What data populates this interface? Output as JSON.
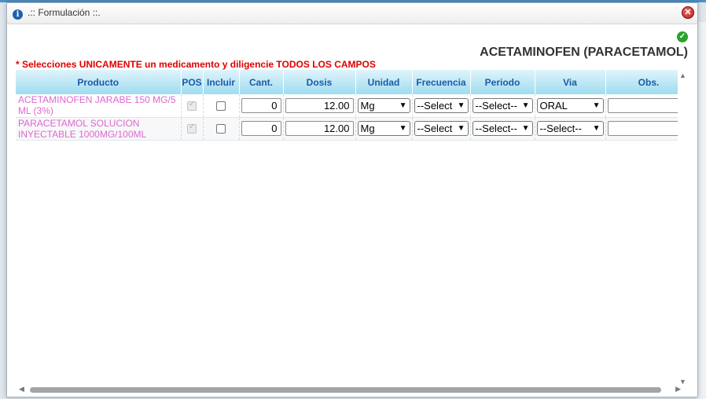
{
  "dialog": {
    "title": ".:: Formulación ::.",
    "close_symbol": "✕"
  },
  "header": {
    "drug_title": "ACETAMINOFEN (PARACETAMOL)",
    "warning": "* Selecciones UNICAMENTE un medicamento y diligencie TODOS LOS CAMPOS"
  },
  "table": {
    "columns": [
      "Producto",
      "POS",
      "Incluir",
      "Cant.",
      "Dosis",
      "Unidad",
      "Frecuencia",
      "Periodo",
      "Via",
      "Obs."
    ],
    "rows": [
      {
        "producto": "ACETAMINOFEN JARABE 150 MG/5 ML (3%)",
        "pos_checked": true,
        "incluir_checked": false,
        "cant": "0",
        "dosis": "12.00",
        "unidad": "Mg",
        "frecuencia": "--Select",
        "periodo": "--Select--",
        "via": "ORAL",
        "obs": ""
      },
      {
        "producto": "PARACETAMOL SOLUCION INYECTABLE 1000MG/100ML",
        "pos_checked": true,
        "incluir_checked": false,
        "cant": "0",
        "dosis": "12.00",
        "unidad": "Mg",
        "frecuencia": "--Select",
        "periodo": "--Select--",
        "via": "--Select--",
        "obs": ""
      }
    ]
  },
  "icons": {
    "info": "info-icon",
    "close": "close-icon",
    "check": "check-circle-icon",
    "dropdown": "chevron-down-icon"
  },
  "colors": {
    "header_text": "#1e5aa6",
    "product_text": "#e066d0",
    "warning_text": "#e00000",
    "check_green": "#2aa32a",
    "close_red": "#c62828"
  }
}
